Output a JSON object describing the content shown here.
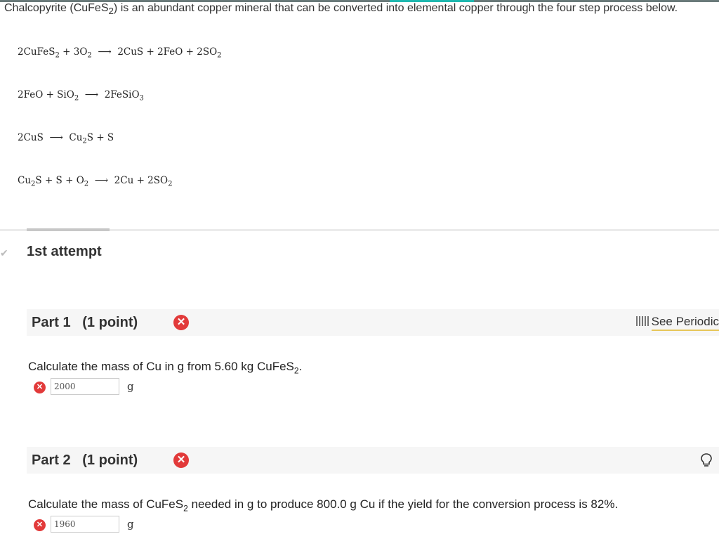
{
  "intro": {
    "prefix": "Chalcopyrite (CuFeS",
    "sub": "2",
    "suffix": ") is an abundant copper mineral that can be converted into elemental copper through the four step process below."
  },
  "equations": [
    {
      "lhs": "2CuFeS2 + 3O2",
      "rhs": "2CuS + 2FeO + 2SO2"
    },
    {
      "lhs": "2FeO + SiO2",
      "rhs": "2FeSiO3"
    },
    {
      "lhs": "2CuS",
      "rhs": "Cu2S + S"
    },
    {
      "lhs": "Cu2S + S + O2",
      "rhs": "2Cu + 2SO2"
    }
  ],
  "attempt": {
    "label": "1st attempt"
  },
  "part1": {
    "title": "Part 1",
    "points": "(1 point)",
    "periodic_label": "See Periodic",
    "question_prefix": "Calculate the mass of Cu in g from 5.60 kg CuFeS",
    "question_sub": "2",
    "question_suffix": ".",
    "answer": "2000",
    "unit": "g",
    "status": "incorrect"
  },
  "part2": {
    "title": "Part 2",
    "points": "(1 point)",
    "question_prefix": "Calculate the mass of CuFeS",
    "question_sub": "2",
    "question_suffix": " needed in g to produce 800.0 g Cu  if the yield for the conversion process is 82%.",
    "answer": "1960",
    "unit": "g",
    "status": "incorrect"
  },
  "icons": {
    "incorrect": "close-circle-icon",
    "hint": "lightbulb-icon",
    "periodic": "periodic-table-icon",
    "check": "check-icon"
  },
  "colors": {
    "error": "#e23a3a",
    "accent": "#1fb8b0",
    "link_underline": "#e7c75a"
  }
}
